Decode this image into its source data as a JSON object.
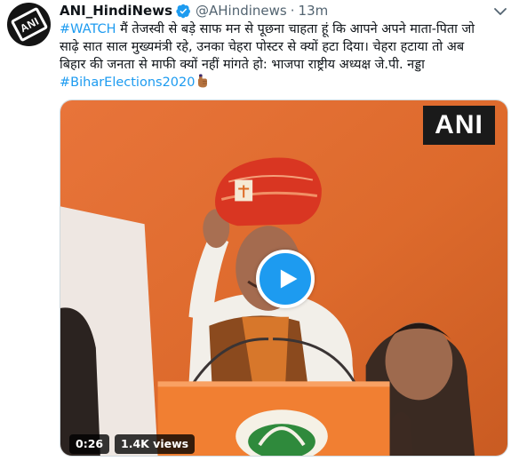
{
  "tweet": {
    "author_name": "ANI_HindiNews",
    "handle": "@AHindinews",
    "separator": "·",
    "time": "13m",
    "avatar_text": "ANI",
    "text_lines": [
      {
        "hashtag": "#WATCH",
        "rest": " मैं तेजस्वी से बड़े साफ मन से पूछना चाहता हूं कि आपने अपने माता-पिता जो"
      },
      {
        "hashtag": "",
        "rest": "साढ़े सात साल मुख्यमंत्री रहे, उनका चेहरा पोस्टर से क्यों हटा दिया। चेहरा हटाया तो अब"
      },
      {
        "hashtag": "",
        "rest": "बिहार की जनता से माफी क्यों नहीं मांगते हो: भाजपा राष्ट्रीय अध्यक्ष जे.पी. नड्डा"
      },
      {
        "hashtag": "#BiharElections2020",
        "rest": ""
      }
    ]
  },
  "media": {
    "watermark": "ANI",
    "duration": "0:26",
    "views": "1.4K views"
  },
  "colors": {
    "link": "#1d9bf0",
    "text": "#0f1419",
    "muted": "#536471",
    "stage_orange": "#e26a27"
  },
  "icons": {
    "verified": "verified-badge-icon",
    "caret": "chevron-down-icon",
    "play": "play-icon",
    "emoji": "voting-finger-emoji"
  }
}
